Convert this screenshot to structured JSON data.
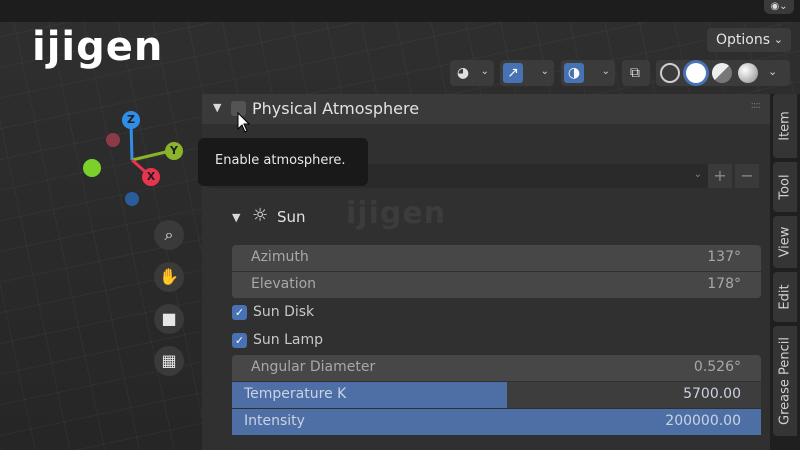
{
  "brand": {
    "logo_text": "ijigen",
    "watermark_text": "ijigen"
  },
  "header": {
    "options_label": "Options",
    "shading_modes": [
      "wireframe",
      "solid",
      "material-preview",
      "rendered"
    ],
    "active_shading": "solid"
  },
  "gizmo": {
    "z_label": "Z",
    "y_label": "Y",
    "x_label": "X"
  },
  "navigation": [
    "zoom",
    "pan",
    "camera",
    "perspective-toggle"
  ],
  "panel": {
    "title": "Physical Atmosphere",
    "enabled": false,
    "tooltip": "Enable atmosphere.",
    "sun": {
      "title": "Sun",
      "azimuth_label": "Azimuth",
      "azimuth_value": "137°",
      "elevation_label": "Elevation",
      "elevation_value": "178°",
      "sun_disk_label": "Sun Disk",
      "sun_disk_checked": true,
      "sun_lamp_label": "Sun Lamp",
      "sun_lamp_checked": true,
      "angular_diameter_label": "Angular Diameter",
      "angular_diameter_value": "0.526°",
      "temperature_label": "Temperature K",
      "temperature_value": "5700.00",
      "temperature_fill_fraction": 0.52,
      "intensity_label": "Intensity",
      "intensity_value": "200000.00",
      "intensity_fill_fraction": 1.0
    }
  },
  "sidebar_tabs": [
    "Item",
    "Tool",
    "View",
    "Edit",
    "Grease Pencil"
  ],
  "colors": {
    "accent_blue": "#4772b3",
    "axis_x": "#e8354f",
    "axis_y": "#8cb42a",
    "axis_z": "#2f8ee6"
  }
}
